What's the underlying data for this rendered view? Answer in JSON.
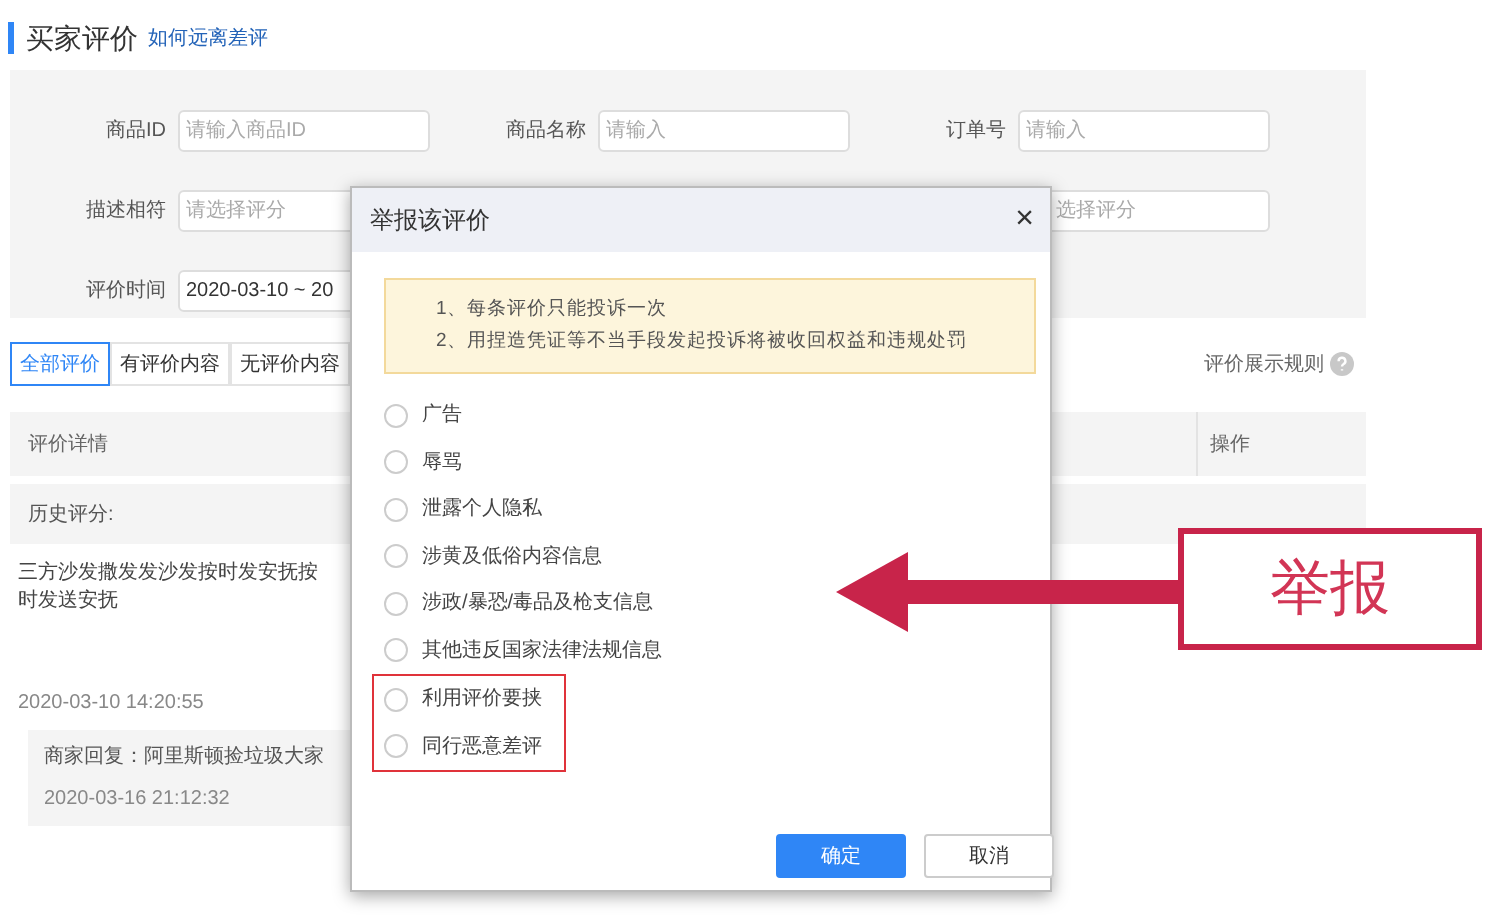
{
  "page": {
    "title": "买家评价",
    "help_link": "如何远离差评"
  },
  "filters": [
    {
      "label": "商品ID",
      "placeholder": "请输入商品ID"
    },
    {
      "label": "商品名称",
      "placeholder": "请输入"
    },
    {
      "label": "订单号",
      "placeholder": "请输入"
    },
    {
      "label": "描述相符",
      "placeholder": "请选择评分"
    },
    {
      "placeholder": "选择评分"
    },
    {
      "label": "评价时间",
      "value": "2020-03-10 ~ 20"
    }
  ],
  "tabs": [
    {
      "label": "全部评价",
      "selected": true
    },
    {
      "label": "有评价内容",
      "selected": false
    },
    {
      "label": "无评价内容",
      "selected": false
    }
  ],
  "rules_link": "评价展示规则",
  "table": {
    "columns": [
      "评价详情",
      "操作"
    ],
    "group_header": "历史评分:",
    "review": {
      "text": "三方沙发撒发发沙发按时发安抚按时发送安抚",
      "time": "2020-03-10 14:20:55",
      "reply": "商家回复：阿里斯顿捡垃圾大家",
      "reply_time": "2020-03-16 21:12:32"
    }
  },
  "dialog": {
    "title": "举报该评价",
    "close": "×",
    "notice": [
      "1、每条评价只能投诉一次",
      "2、用捏造凭证等不当手段发起投诉将被收回权益和违规处罚"
    ],
    "options": [
      {
        "label": "广告",
        "selected": false
      },
      {
        "label": "辱骂",
        "selected": false
      },
      {
        "label": "泄露个人隐私",
        "selected": false
      },
      {
        "label": "涉黄及低俗内容信息",
        "selected": false
      },
      {
        "label": "涉政/暴恐/毒品及枪支信息",
        "selected": false
      },
      {
        "label": "其他违反国家法律法规信息",
        "selected": false
      }
    ],
    "highlighted_options": [
      {
        "label": "利用评价要挟",
        "selected": false
      },
      {
        "label": "同行恶意差评",
        "selected": false
      }
    ],
    "buttons": [
      {
        "label": "确定",
        "kind": "primary"
      },
      {
        "label": "取消",
        "kind": "secondary"
      }
    ]
  },
  "callout": {
    "label": "举报"
  }
}
